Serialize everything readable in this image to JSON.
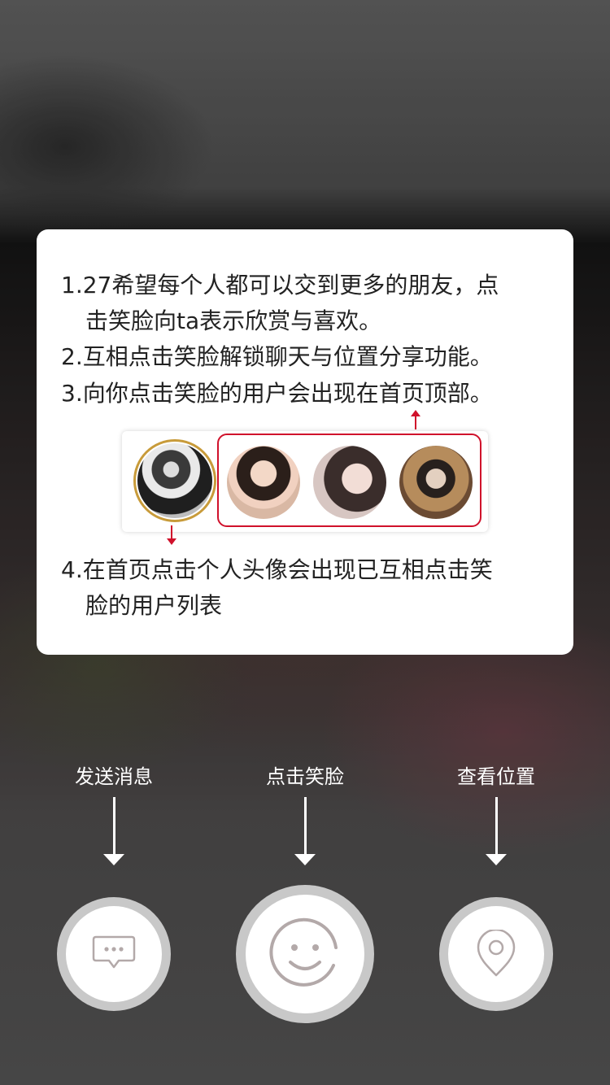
{
  "guide": {
    "line1": "1.27希望每个人都可以交到更多的朋友，点",
    "line1_cont": "击笑脸向ta表示欣赏与喜欢。",
    "line2": "2.互相点击笑脸解锁聊天与位置分享功能。",
    "line3": "3.向你点击笑脸的用户会出现在首页顶部。",
    "line4": "4.在首页点击个人头像会出现已互相点击笑",
    "line4_cont": "脸的用户列表"
  },
  "actions": {
    "message": {
      "label": "发送消息",
      "icon": "chat-bubble-icon"
    },
    "smile": {
      "label": "点击笑脸",
      "icon": "smiley-face-icon"
    },
    "location": {
      "label": "查看位置",
      "icon": "location-pin-icon"
    }
  },
  "colors": {
    "accent_red": "#d0112b",
    "avatar_ring_gold": "#c89b3a",
    "button_ring": "#c8c8c8",
    "icon_gray": "#b3a9a9"
  }
}
